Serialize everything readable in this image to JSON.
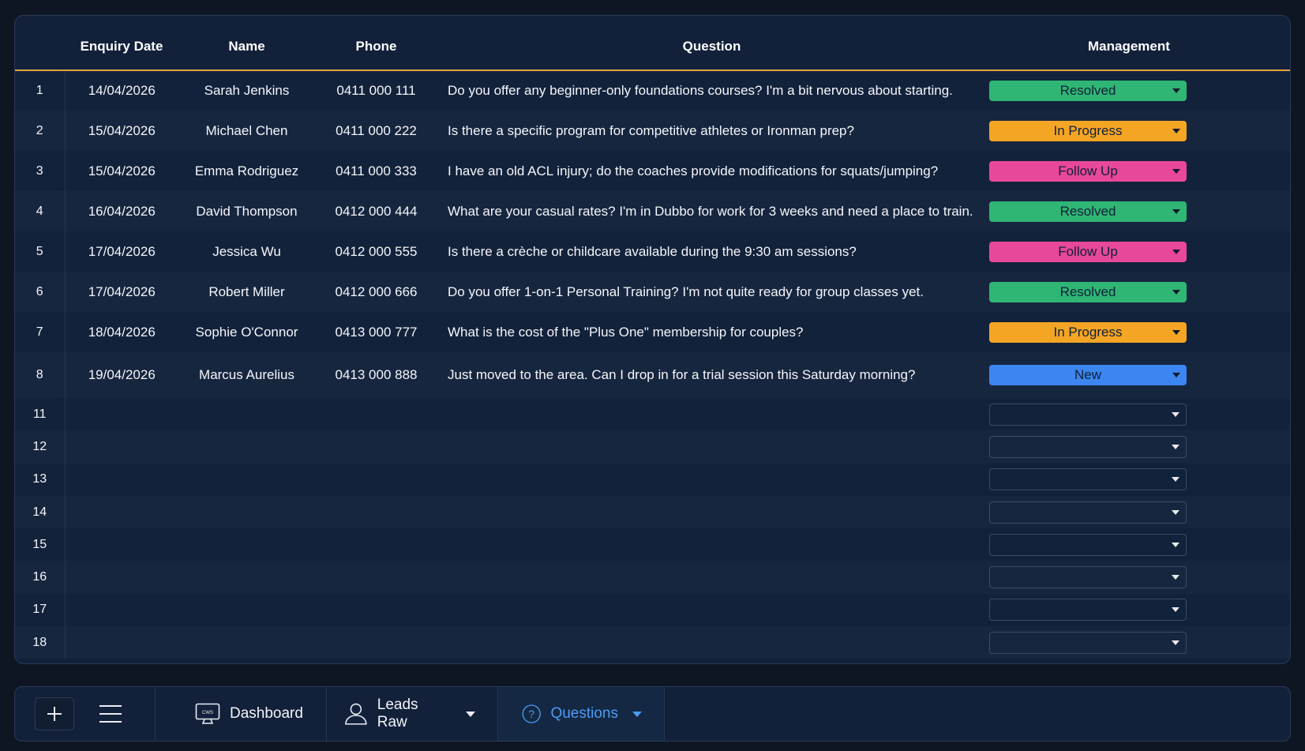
{
  "table": {
    "headers": [
      "",
      "Enquiry Date",
      "Name",
      "Phone",
      "Question",
      "Management"
    ],
    "rows": [
      {
        "n": "1",
        "date": "14/04/2026",
        "name": "Sarah Jenkins",
        "phone": "0411 000 111",
        "question": "Do you offer any beginner-only foundations courses? I'm a bit nervous about starting.",
        "status": "Resolved"
      },
      {
        "n": "2",
        "date": "15/04/2026",
        "name": "Michael Chen",
        "phone": "0411 000 222",
        "question": "Is there a specific program for competitive athletes or Ironman prep?",
        "status": "In Progress"
      },
      {
        "n": "3",
        "date": "15/04/2026",
        "name": "Emma Rodriguez",
        "phone": "0411 000 333",
        "question": "I have an old ACL injury; do the coaches provide modifications for squats/jumping?",
        "status": "Follow Up"
      },
      {
        "n": "4",
        "date": "16/04/2026",
        "name": "David Thompson",
        "phone": "0412 000 444",
        "question": "What are your casual rates? I'm in Dubbo for work for 3 weeks and need a place to train.",
        "status": "Resolved"
      },
      {
        "n": "5",
        "date": "17/04/2026",
        "name": "Jessica Wu",
        "phone": "0412 000 555",
        "question": "Is there a crèche or childcare available during the 9:30 am sessions?",
        "status": "Follow Up"
      },
      {
        "n": "6",
        "date": "17/04/2026",
        "name": "Robert Miller",
        "phone": "0412 000 666",
        "question": "Do you offer 1-on-1 Personal Training? I'm not quite ready for group classes yet.",
        "status": "Resolved"
      },
      {
        "n": "7",
        "date": "18/04/2026",
        "name": "Sophie O'Connor",
        "phone": "0413 000 777",
        "question": "What is the cost of the \"Plus One\" membership for couples?",
        "status": "In Progress"
      },
      {
        "n": "8",
        "date": "19/04/2026",
        "name": "Marcus Aurelius",
        "phone": "0413 000 888",
        "question": "Just moved to the area. Can I drop in for a trial session this Saturday morning?",
        "status": "New"
      }
    ],
    "empty_rows": [
      "11",
      "12",
      "13",
      "14",
      "15",
      "16",
      "17",
      "18"
    ]
  },
  "status_colors": {
    "Resolved": "#2fb574",
    "In Progress": "#f5a524",
    "Follow Up": "#e8489a",
    "New": "#3b86f0"
  },
  "toolbar": {
    "add_icon": "plus-icon",
    "menu_icon": "hamburger-icon",
    "tabs": [
      {
        "label": "Dashboard",
        "icon": "monitor-icon"
      },
      {
        "label": "Leads Raw",
        "icon": "user-icon"
      },
      {
        "label": "Questions",
        "icon": "question-circle-icon"
      }
    ],
    "monitor_text": "CWS"
  }
}
